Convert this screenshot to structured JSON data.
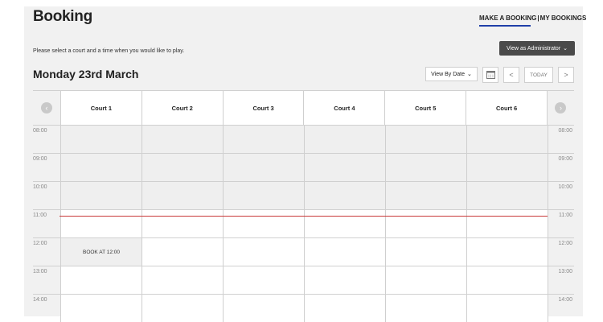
{
  "header": {
    "title": "Booking",
    "nav": {
      "make_booking": "MAKE A BOOKING",
      "separator": "|",
      "my_bookings": "MY BOOKINGS"
    },
    "admin_button": {
      "label": "View as Administrator",
      "icon": "chevron-down-icon"
    }
  },
  "intro": "Please select a court and a time when you would like to play.",
  "date_title": "Monday 23rd March",
  "toolbar": {
    "view_select": "View By Date",
    "calendar_icon": "calendar-icon",
    "prev_icon": "chevron-left-icon",
    "today_label": "TODAY",
    "next_icon": "chevron-right-icon"
  },
  "schedule": {
    "courts": [
      "Court 1",
      "Court 2",
      "Court 3",
      "Court 4",
      "Court 5",
      "Court 6"
    ],
    "times": [
      "08:00",
      "09:00",
      "10:00",
      "11:00",
      "12:00",
      "13:00",
      "14:00"
    ],
    "book_label": "BOOK AT 12:00",
    "prev_glyph": "‹",
    "next_glyph": "›"
  },
  "colors": {
    "accent_underline": "#1f3fa8",
    "now_line": "#c83a3a",
    "admin_button_bg": "#4a4a4a"
  }
}
